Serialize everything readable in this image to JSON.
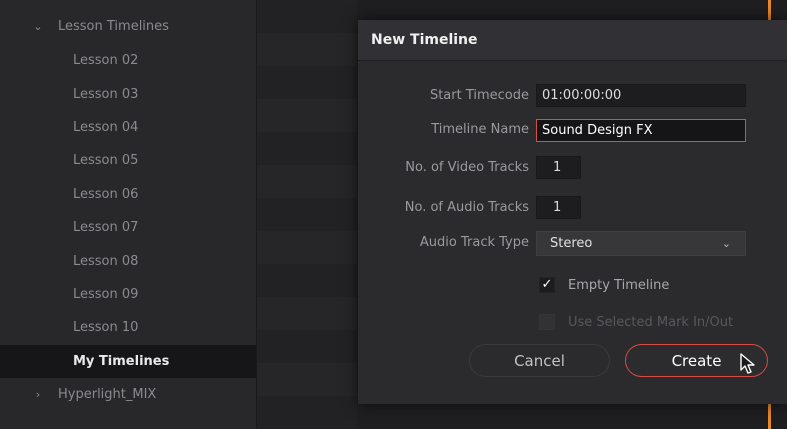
{
  "sidebar": {
    "items": [
      {
        "label": "Lesson Timelines",
        "chevron": "⌄",
        "level": 0,
        "selected": false
      },
      {
        "label": "Lesson 02",
        "level": 1,
        "selected": false
      },
      {
        "label": "Lesson 03",
        "level": 1,
        "selected": false
      },
      {
        "label": "Lesson 04",
        "level": 1,
        "selected": false
      },
      {
        "label": "Lesson 05",
        "level": 1,
        "selected": false
      },
      {
        "label": "Lesson 06",
        "level": 1,
        "selected": false
      },
      {
        "label": "Lesson 07",
        "level": 1,
        "selected": false
      },
      {
        "label": "Lesson 08",
        "level": 1,
        "selected": false
      },
      {
        "label": "Lesson 09",
        "level": 1,
        "selected": false
      },
      {
        "label": "Lesson 10",
        "level": 1,
        "selected": false
      },
      {
        "label": "My Timelines",
        "level": 1,
        "selected": true
      },
      {
        "label": "Hyperlight_MIX",
        "chevron": "›",
        "level": 0,
        "selected": false
      }
    ]
  },
  "dialog": {
    "title": "New Timeline",
    "fields": {
      "start_timecode": {
        "label": "Start Timecode",
        "value": "01:00:00:00"
      },
      "timeline_name": {
        "label": "Timeline Name",
        "value": "Sound Design FX"
      },
      "video_tracks": {
        "label": "No. of Video Tracks",
        "value": "1"
      },
      "audio_tracks": {
        "label": "No. of Audio Tracks",
        "value": "1"
      },
      "audio_track_type": {
        "label": "Audio Track Type",
        "value": "Stereo",
        "chevron": "⌄"
      }
    },
    "checkboxes": {
      "empty_timeline": {
        "label": "Empty Timeline",
        "checked": true,
        "mark": "✓"
      },
      "use_selected_mark": {
        "label": "Use Selected Mark In/Out",
        "checked": false,
        "enabled": false
      }
    },
    "buttons": {
      "cancel": "Cancel",
      "create": "Create"
    }
  },
  "colors": {
    "accent": "#d84a44",
    "playhead": "#e8892a",
    "panel": "#2b2b2e",
    "sidebar": "#28282b"
  },
  "icons": {
    "cursor": "mouse-pointer-icon",
    "expanded": "chevron-down-icon",
    "collapsed": "chevron-right-icon"
  }
}
